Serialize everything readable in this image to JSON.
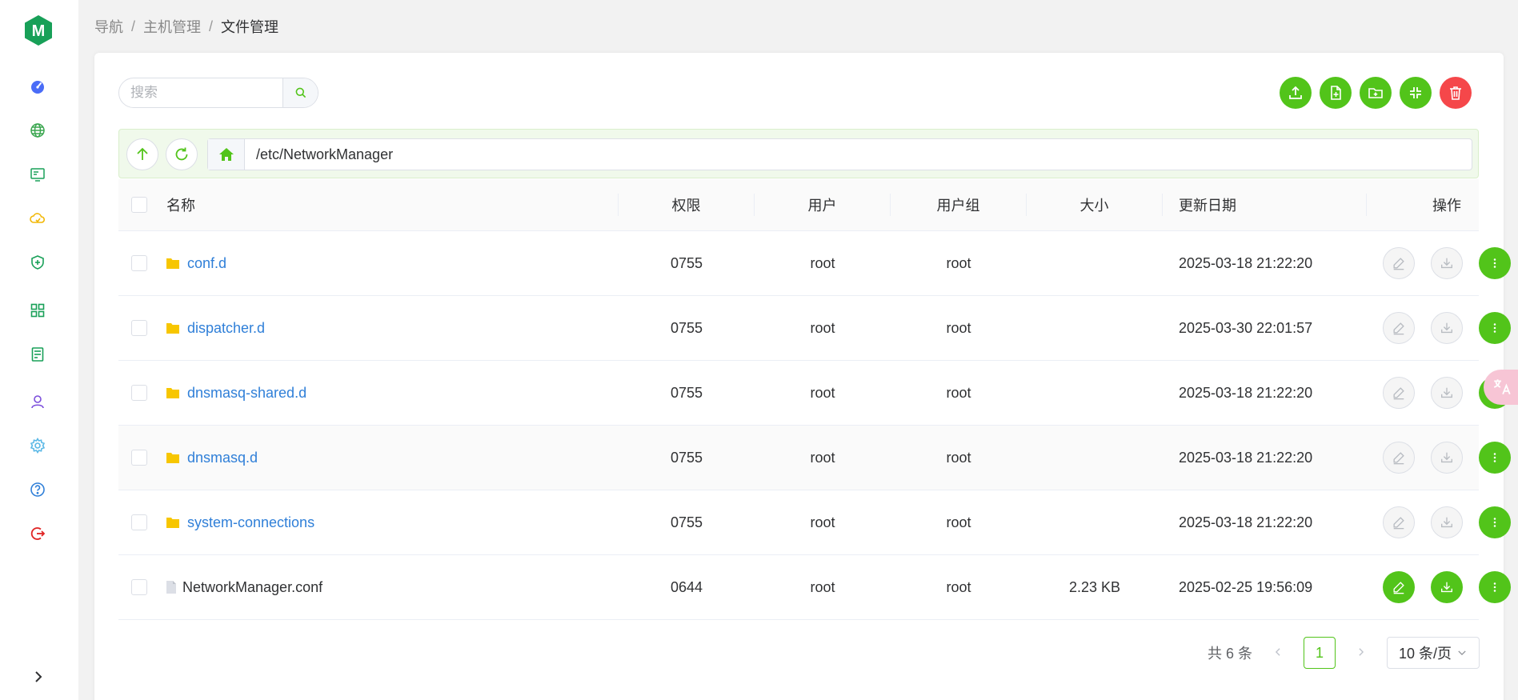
{
  "breadcrumb": {
    "item1": "导航",
    "item2": "主机管理",
    "current": "文件管理",
    "separator": "/"
  },
  "search": {
    "placeholder": "搜索"
  },
  "path": {
    "value": "/etc/NetworkManager"
  },
  "table": {
    "headers": {
      "name": "名称",
      "perm": "权限",
      "user": "用户",
      "group": "用户组",
      "size": "大小",
      "date": "更新日期",
      "ops": "操作"
    },
    "rows": [
      {
        "name": "conf.d",
        "perm": "0755",
        "user": "root",
        "group": "root",
        "size": "",
        "date": "2025-03-18 21:22:20"
      },
      {
        "name": "dispatcher.d",
        "perm": "0755",
        "user": "root",
        "group": "root",
        "size": "",
        "date": "2025-03-30 22:01:57"
      },
      {
        "name": "dnsmasq-shared.d",
        "perm": "0755",
        "user": "root",
        "group": "root",
        "size": "",
        "date": "2025-03-18 21:22:20"
      },
      {
        "name": "dnsmasq.d",
        "perm": "0755",
        "user": "root",
        "group": "root",
        "size": "",
        "date": "2025-03-18 21:22:20"
      },
      {
        "name": "system-connections",
        "perm": "0755",
        "user": "root",
        "group": "root",
        "size": "",
        "date": "2025-03-18 21:22:20"
      },
      {
        "name": "NetworkManager.conf",
        "perm": "0644",
        "user": "root",
        "group": "root",
        "size": "2.23 KB",
        "date": "2025-02-25 19:56:09"
      }
    ]
  },
  "pagination": {
    "total": "共 6 条",
    "current_page": "1",
    "page_size": "10 条/页"
  },
  "logo": {
    "letter": "M"
  },
  "colors": {
    "accent": "#52c41a",
    "danger": "#f5474a",
    "link": "#2f7fd8",
    "folder": "#f7c600"
  },
  "icons": {
    "sidebar": [
      "dashboard-icon",
      "globe-icon",
      "host-icon",
      "cloud-icon",
      "shield-icon",
      "apps-icon",
      "server-icon",
      "user-icon",
      "gear-icon",
      "help-icon",
      "logout-icon"
    ],
    "toolbar": [
      "upload-icon",
      "new-file-icon",
      "new-folder-icon",
      "compress-icon",
      "trash-icon"
    ]
  }
}
